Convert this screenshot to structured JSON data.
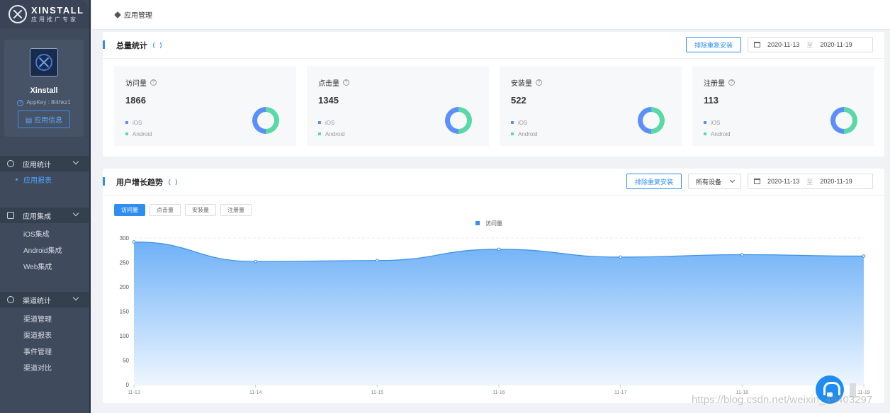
{
  "brand": {
    "name": "XINSTALL",
    "subtitle": "应用推广专家"
  },
  "profile": {
    "app_name": "Xinstall",
    "appkey": "AppKey : 8l4hkz1",
    "info_button": "应用信息"
  },
  "sidebar": {
    "groups": [
      {
        "title": "应用统计",
        "icon": "pie-chart-icon",
        "items": [
          {
            "label": "应用报表",
            "active": true
          }
        ]
      },
      {
        "title": "应用集成",
        "icon": "cube-icon",
        "items": [
          {
            "label": "iOS集成"
          },
          {
            "label": "Android集成"
          },
          {
            "label": "Web集成"
          }
        ]
      },
      {
        "title": "渠道统计",
        "icon": "share-icon",
        "items": [
          {
            "label": "渠道管理"
          },
          {
            "label": "渠道报表"
          },
          {
            "label": "事件管理"
          },
          {
            "label": "渠道对比"
          }
        ]
      }
    ]
  },
  "breadcrumb": {
    "label": "应用管理"
  },
  "overview": {
    "title": "总量统计",
    "dedupe_button": "排除重复安装",
    "date_start": "2020-11-13",
    "date_sep": "至",
    "date_end": "2020-11-19",
    "legend_ios": "iOS",
    "legend_android": "Android",
    "cards": [
      {
        "label": "访问量",
        "value": "1866"
      },
      {
        "label": "点击量",
        "value": "1345"
      },
      {
        "label": "安装量",
        "value": "522"
      },
      {
        "label": "注册量",
        "value": "113"
      }
    ],
    "colors": {
      "ios": "#5b8ff9",
      "android": "#5ad8a6"
    }
  },
  "trend": {
    "title": "用户增长趋势",
    "dedupe_button": "排除重复安装",
    "device_select": "所有设备",
    "date_start": "2020-11-13",
    "date_sep": "至",
    "date_end": "2020-11-19",
    "tabs": [
      {
        "label": "访问量",
        "active": true
      },
      {
        "label": "点击量"
      },
      {
        "label": "安装量"
      },
      {
        "label": "注册量"
      }
    ]
  },
  "chart_data": {
    "type": "area",
    "x": [
      "11-13",
      "11-14",
      "11-15",
      "11-16",
      "11-17",
      "11-18",
      "11-19"
    ],
    "series": [
      {
        "name": "访问量",
        "values": [
          292,
          252,
          254,
          277,
          261,
          266,
          263
        ]
      }
    ],
    "ylim": [
      0,
      300
    ],
    "yticks": [
      0,
      50,
      100,
      150,
      200,
      250,
      300
    ],
    "grid": true,
    "legend": "top-center",
    "color": "#3a8ee6"
  },
  "watermark": "https://blog.csdn.net/weixin_49403297"
}
